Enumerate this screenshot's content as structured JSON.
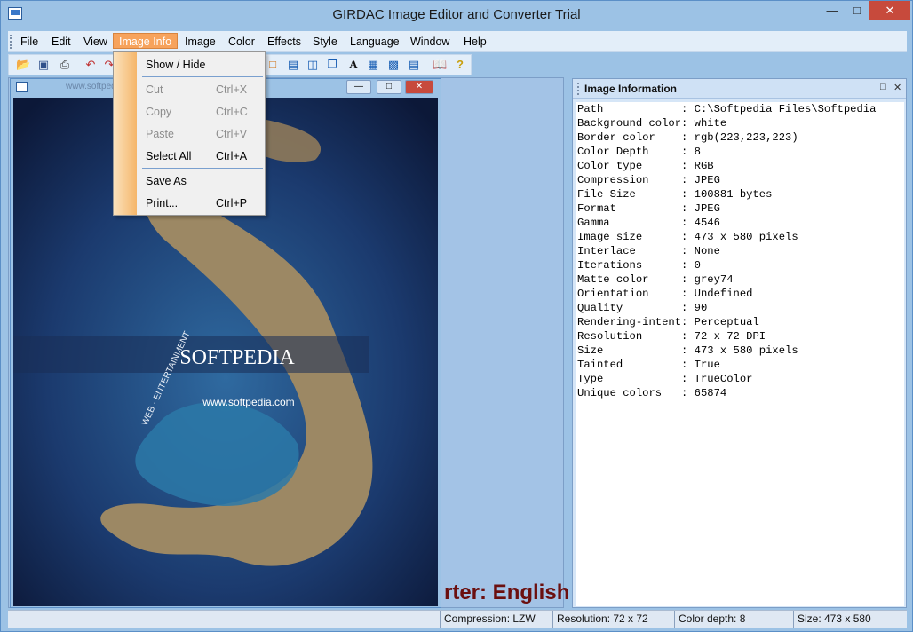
{
  "window": {
    "title": "GIRDAC Image Editor and Converter Trial"
  },
  "menubar": {
    "items": [
      "File",
      "Edit",
      "View",
      "Image Info",
      "Image",
      "Color",
      "Effects",
      "Style",
      "Language",
      "Window",
      "Help"
    ]
  },
  "image_window": {
    "watermark": "www.softpedia.com",
    "image_brand": "SOFTPEDIA",
    "image_url": "www.softpedia.com",
    "image_side_text": "WEB · ENTERTAINMENT"
  },
  "background_text": "rter: English",
  "dropdown": {
    "show_hide": "Show / Hide",
    "cut": "Cut",
    "cut_shortcut": "Ctrl+X",
    "copy": "Copy",
    "copy_shortcut": "Ctrl+C",
    "paste": "Paste",
    "paste_shortcut": "Ctrl+V",
    "select_all": "Select All",
    "select_all_shortcut": "Ctrl+A",
    "save_as": "Save As",
    "print": "Print...",
    "print_shortcut": "Ctrl+P"
  },
  "info_panel": {
    "title": "Image Information",
    "rows": [
      "Path            : C:\\Softpedia Files\\Softpedia",
      "Background color: white",
      "Border color    : rgb(223,223,223)",
      "Color Depth     : 8",
      "Color type      : RGB",
      "Compression     : JPEG",
      "File Size       : 100881 bytes",
      "Format          : JPEG",
      "Gamma           : 4546",
      "Image size      : 473 x 580 pixels",
      "Interlace       : None",
      "Iterations      : 0",
      "Matte color     : grey74",
      "Orientation     : Undefined",
      "Quality         : 90",
      "Rendering-intent: Perceptual",
      "Resolution      : 72 x 72 DPI",
      "Size            : 473 x 580 pixels",
      "Tainted         : True",
      "Type            : TrueColor",
      "Unique colors   : 65874"
    ]
  },
  "statusbar": {
    "compression": "Compression: LZW",
    "resolution": "Resolution: 72 x 72",
    "color_depth": "Color depth: 8",
    "size": "Size: 473 x 580"
  }
}
